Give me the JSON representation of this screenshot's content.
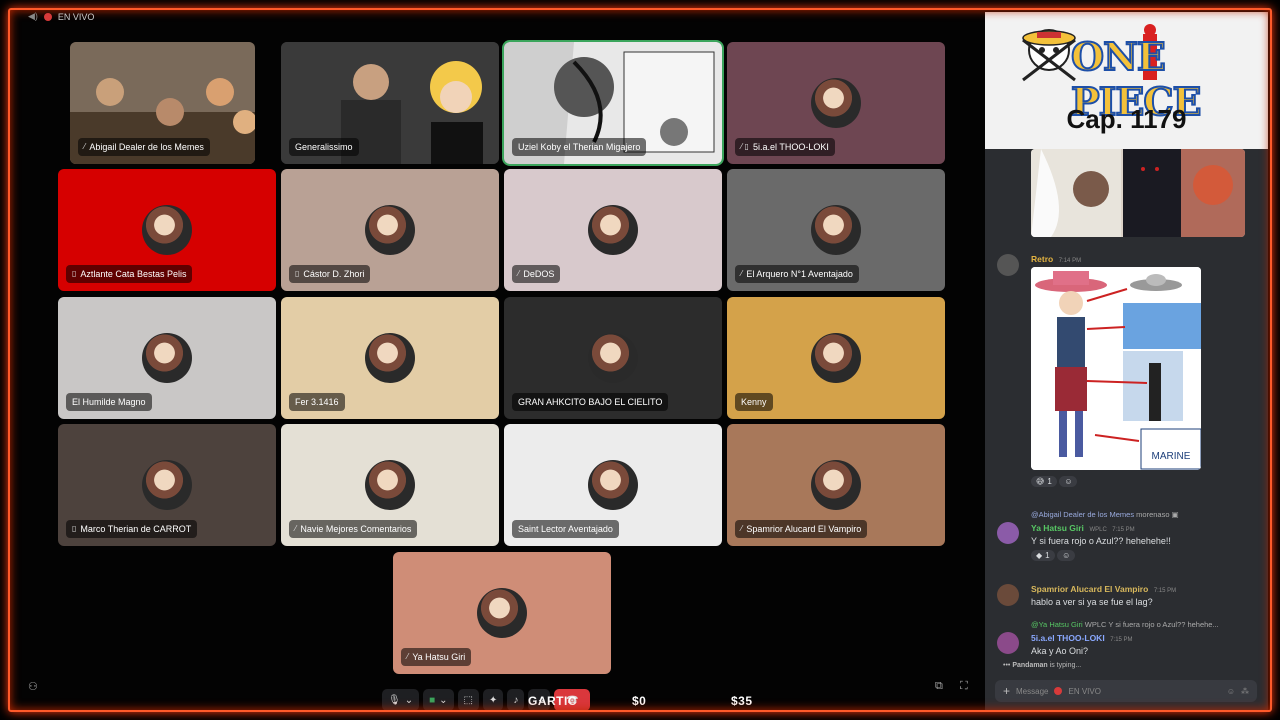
{
  "topbar": {
    "live_label": "EN VIVO"
  },
  "tiles": [
    {
      "name": "Abigail Dealer de los Memes",
      "icon": "muted-icon",
      "bg": "#3a2c22",
      "kind": "photo"
    },
    {
      "name": "Generalissimo",
      "icon": "",
      "bg": "#2f2f2f",
      "kind": "photo"
    },
    {
      "name": "Uziel Koby el Therian Migajero",
      "icon": "",
      "bg": "#d8d8d8",
      "kind": "manga"
    },
    {
      "name": "5i.a.el THOO-LOKI",
      "icon": "muted-phone-icon",
      "bg": "#6e4652",
      "kind": "avatar"
    },
    {
      "name": "Aztlante Cata Bestas Pelis",
      "icon": "phone-icon",
      "bg": "#d60000",
      "kind": "avatar"
    },
    {
      "name": "Cástor D. Zhori",
      "icon": "phone-icon",
      "bg": "#b9a195",
      "kind": "avatar"
    },
    {
      "name": "DeDOS",
      "icon": "muted-icon",
      "bg": "#d8c9cc",
      "kind": "avatar"
    },
    {
      "name": "El Arquero N°1 Aventajado",
      "icon": "muted-icon",
      "bg": "#6a6a6a",
      "kind": "avatar"
    },
    {
      "name": "El Humilde Magno",
      "icon": "",
      "bg": "#c9c7c6",
      "kind": "avatar"
    },
    {
      "name": "Fer 3.1416",
      "icon": "",
      "bg": "#e3cda6",
      "kind": "avatar"
    },
    {
      "name": "GRAN AHKCITO BAJO EL CIELITO",
      "icon": "",
      "bg": "#2c2c2c",
      "kind": "avatar"
    },
    {
      "name": "Kenny",
      "icon": "",
      "bg": "#d4a24a",
      "kind": "avatar"
    },
    {
      "name": "Marco Therian de CARROT",
      "icon": "phone-icon",
      "bg": "#4d423d",
      "kind": "avatar"
    },
    {
      "name": "Navie Mejores Comentarios",
      "icon": "muted-icon",
      "bg": "#e4e0d5",
      "kind": "avatar"
    },
    {
      "name": "Saint Lector Aventajado",
      "icon": "",
      "bg": "#ececec",
      "kind": "avatar"
    },
    {
      "name": "Spamrior Alucard El Vampiro",
      "icon": "muted-icon",
      "bg": "#a8785a",
      "kind": "avatar"
    },
    {
      "name": "Ya Hatsu Giri",
      "icon": "muted-icon",
      "bg": "#cf8d77",
      "kind": "avatar"
    }
  ],
  "overlay": {
    "logo": "ONE PIECE",
    "chapter": "Cap. 1179"
  },
  "chat": {
    "retro": {
      "author": "Retro",
      "time": "7:14 PM",
      "reaction_count": "1"
    },
    "msg2": {
      "reply_to": "@Abigail Dealer de los Memes",
      "reply_text": "morenaso",
      "author": "Ya Hatsu Giri",
      "tag": "WPLC",
      "time": "7:15 PM",
      "text": "Y si fuera rojo o Azul?? hehehehe!!",
      "reaction_count": "1"
    },
    "msg3": {
      "author": "Spamrior Alucard El Vampiro",
      "time": "7:15 PM",
      "text": "hablo a ver si ya se fue el lag?"
    },
    "msg4": {
      "reply_to": "@Ya Hatsu Giri",
      "reply_tag": "WPLC",
      "reply_text": "Y si fuera rojo o Azul?? hehehe...",
      "author": "5i.a.el THOO-LOKI",
      "time": "7:15 PM",
      "text": "Aka y Ao Oni?"
    },
    "typing": {
      "user": "Pandaman",
      "text": "is typing..."
    },
    "input_placeholder": "Message",
    "input_live": "EN VIVO"
  },
  "ticker": {
    "game": "GARTIC",
    "amount1": "$0",
    "amount2": "$35"
  },
  "colors": {
    "frame": "#ff5a2a",
    "author_retro": "#e3b341",
    "author_yahatsu": "#57c764",
    "author_spamrior": "#d8b85c",
    "author_thoo": "#8aa8ff"
  }
}
